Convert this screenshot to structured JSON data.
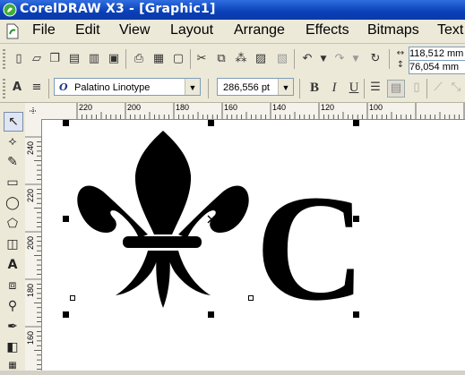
{
  "window": {
    "title": "CorelDRAW X3 - [Graphic1]"
  },
  "menu": [
    "File",
    "Edit",
    "View",
    "Layout",
    "Arrange",
    "Effects",
    "Bitmaps",
    "Text"
  ],
  "toolbar": {
    "size": {
      "width": "118,512 mm",
      "height": "76,054 mm"
    }
  },
  "property_bar": {
    "font_name": "Palatino Linotype",
    "font_size": "286,556 pt",
    "bold": "B",
    "italic": "I",
    "underline": "U"
  },
  "rulers": {
    "horizontal": [
      "220",
      "200",
      "180",
      "160",
      "140",
      "120",
      "100"
    ],
    "vertical": [
      "240",
      "220",
      "200",
      "180",
      "160"
    ]
  },
  "canvas": {
    "text_object": "C"
  },
  "colors": {
    "titlebar": "#0a3fb8",
    "chrome": "#ece9d8",
    "canvas": "#ffffff",
    "artwork": "#000000"
  }
}
